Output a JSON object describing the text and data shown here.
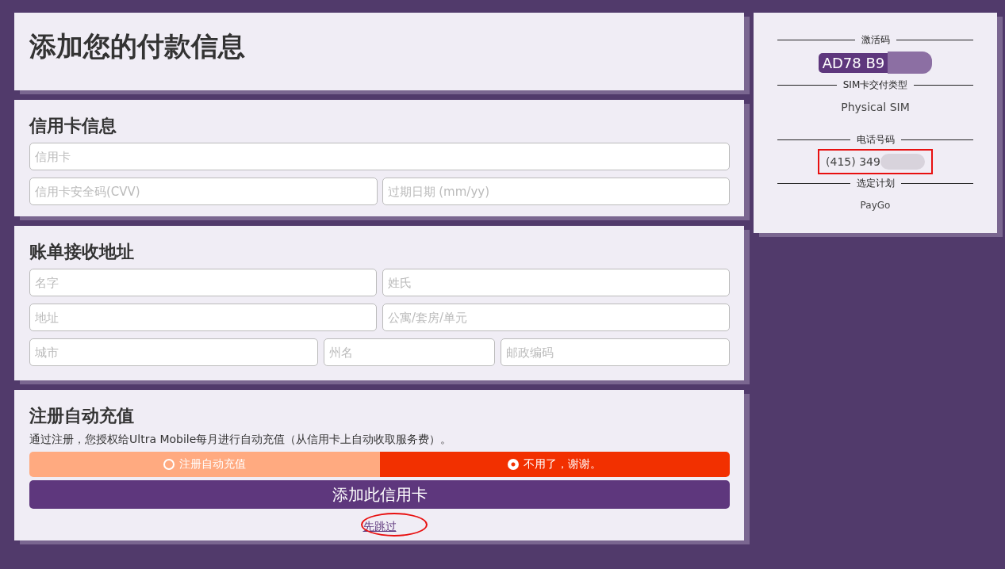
{
  "page_title": "添加您的付款信息",
  "credit_card": {
    "heading": "信用卡信息",
    "fields": [
      {
        "placeholder": "信用卡"
      },
      {
        "placeholder": "信用卡安全码(CVV)"
      },
      {
        "placeholder": "过期日期 (mm/yy)"
      }
    ]
  },
  "billing_address": {
    "heading": "账单接收地址",
    "rows": [
      [
        {
          "placeholder": "名字"
        },
        {
          "placeholder": "姓氏"
        }
      ],
      [
        {
          "placeholder": "地址"
        },
        {
          "placeholder": "公寓/套房/单元"
        }
      ],
      [
        {
          "placeholder": "城市"
        },
        {
          "placeholder": "州名"
        },
        {
          "placeholder": "邮政编码"
        }
      ]
    ]
  },
  "autopay": {
    "heading": "注册自动充值",
    "description": "通过注册，您授权给Ultra Mobile每月进行自动充值（从信用卡上自动收取服务费）。",
    "options": [
      {
        "label": "注册自动充值",
        "selected": false
      },
      {
        "label": "不用了，谢谢。",
        "selected": true
      }
    ],
    "submit": "添加此信用卡",
    "skip": {
      "text": "先跳过",
      "highlighted": true
    }
  },
  "summary": [
    {
      "label": "激活码",
      "value": "AD78 B9",
      "kind": "code",
      "redacted": true,
      "highlighted": false
    },
    {
      "label": "SIM卡交付类型",
      "value": "Physical SIM",
      "kind": "text",
      "redacted": false,
      "highlighted": false
    },
    {
      "label": "电话号码",
      "value": "(415) 349",
      "kind": "text",
      "redacted": true,
      "highlighted": true
    },
    {
      "label": "选定计划",
      "value": "PayGo",
      "kind": "small",
      "redacted": false,
      "highlighted": false
    }
  ]
}
